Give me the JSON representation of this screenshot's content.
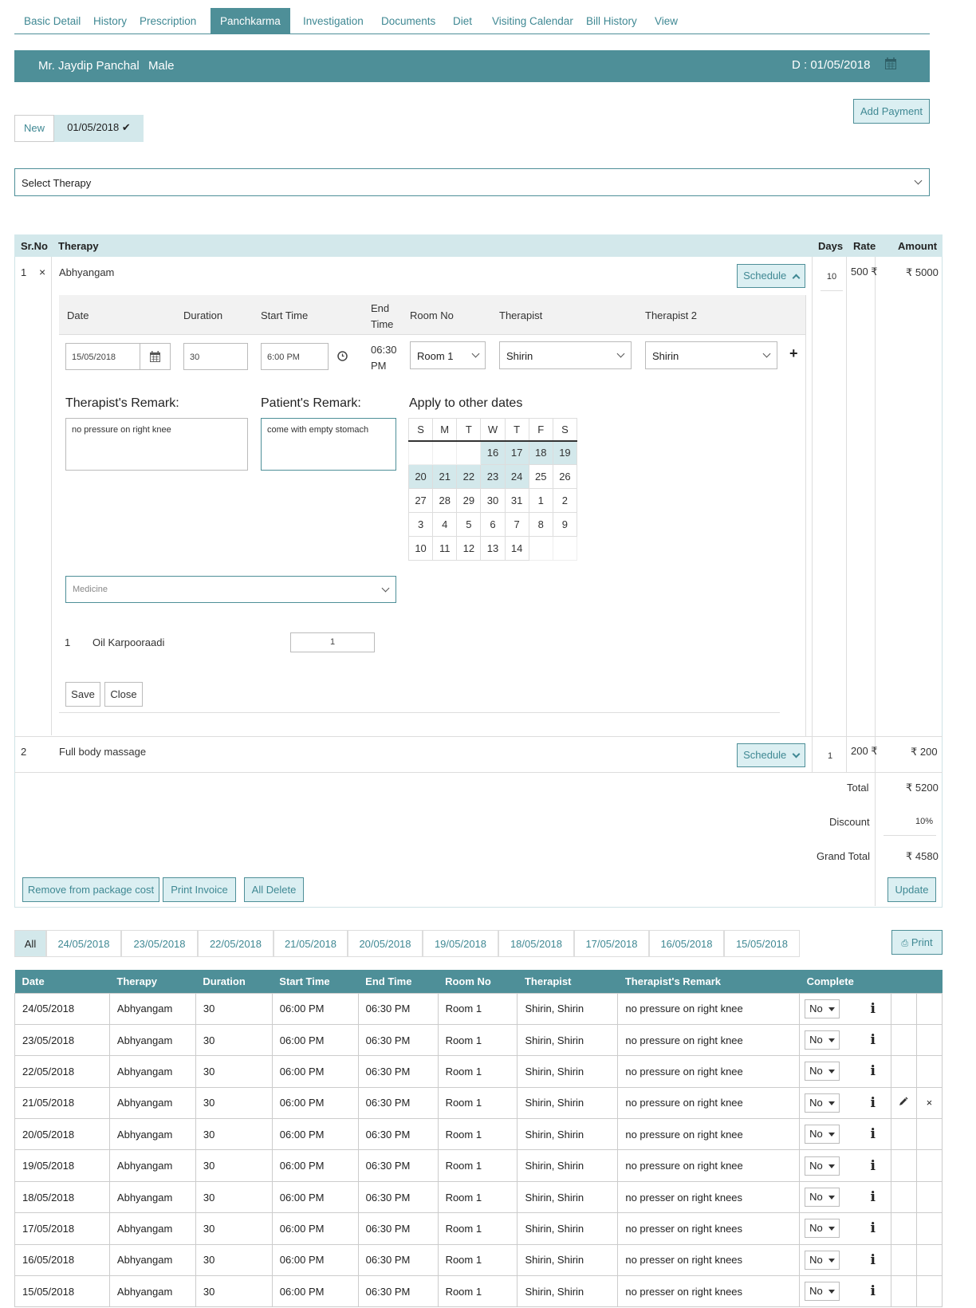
{
  "nav": {
    "tabs": [
      "Basic Detail",
      "History",
      "Prescription",
      "Panchkarma",
      "Investigation",
      "Documents",
      "Diet",
      "Visiting Calendar",
      "Bill History",
      "View"
    ],
    "active": "Panchkarma"
  },
  "patient": {
    "name": "Mr. Jaydip Panchal",
    "gender": "Male",
    "date": "D : 01/05/2018"
  },
  "add_payment": "Add Payment",
  "visit_tabs": {
    "new": "New",
    "date": "01/05/2018 ✔"
  },
  "select_therapy": "Select Therapy",
  "table_header": {
    "srno": "Sr.No",
    "therapy": "Therapy",
    "days": "Days",
    "rate": "Rate",
    "amount": "Amount"
  },
  "rows": [
    {
      "sr": "1",
      "remove": "×",
      "therapy": "Abhyangam",
      "schedule": "Schedule",
      "days": "10",
      "rate": "500 ₹",
      "amount": "₹ 5000"
    },
    {
      "sr": "2",
      "therapy": "Full body massage",
      "schedule": "Schedule",
      "days": "1",
      "rate": "200 ₹",
      "amount": "₹ 200"
    }
  ],
  "schedule_form": {
    "headers": {
      "date": "Date",
      "duration": "Duration",
      "start": "Start Time",
      "end": "End Time",
      "room": "Room No",
      "therapist": "Therapist",
      "therapist2": "Therapist 2"
    },
    "date": "15/05/2018",
    "duration": "30",
    "start": "6:00 PM",
    "end": "06:30 PM",
    "room": "Room 1",
    "therapist": "Shirin",
    "therapist2": "Shirin",
    "therapist_remark_label": "Therapist's Remark:",
    "therapist_remark": "no pressure on right knee",
    "patient_remark_label": "Patient's Remark:",
    "patient_remark": "come with empty stomach",
    "apply_label": "Apply to other dates",
    "calendar": {
      "days": [
        "S",
        "M",
        "T",
        "W",
        "T",
        "F",
        "S"
      ],
      "weeks": [
        [
          "",
          "",
          "",
          "16",
          "17",
          "18",
          "19"
        ],
        [
          "20",
          "21",
          "22",
          "23",
          "24",
          "25",
          "26"
        ],
        [
          "27",
          "28",
          "29",
          "30",
          "31",
          "1",
          "2"
        ],
        [
          "3",
          "4",
          "5",
          "6",
          "7",
          "8",
          "9"
        ],
        [
          "10",
          "11",
          "12",
          "13",
          "14",
          "",
          ""
        ]
      ],
      "selected": [
        "16",
        "17",
        "18",
        "19",
        "20",
        "21",
        "22",
        "23",
        "24"
      ]
    },
    "medicine_placeholder": "Medicine",
    "medicine": {
      "no": "1",
      "name": "Oil Karpooraadi",
      "qty": "1"
    },
    "save": "Save",
    "close": "Close"
  },
  "totals": {
    "total_label": "Total",
    "total": "₹ 5200",
    "discount_label": "Discount",
    "discount": "10%",
    "grand_label": "Grand Total",
    "grand": "₹ 4580"
  },
  "actions": {
    "remove_pkg": "Remove from package cost",
    "print_invoice": "Print Invoice",
    "all_delete": "All Delete",
    "update": "Update"
  },
  "date_tabs": [
    "All",
    "24/05/2018",
    "23/05/2018",
    "22/05/2018",
    "21/05/2018",
    "20/05/2018",
    "19/05/2018",
    "18/05/2018",
    "17/05/2018",
    "16/05/2018",
    "15/05/2018"
  ],
  "print": "Print",
  "schedule_table": {
    "headers": [
      "Date",
      "Therapy",
      "Duration",
      "Start Time",
      "End Time",
      "Room No",
      "Therapist",
      "Therapist's Remark",
      "Complete"
    ],
    "rows": [
      {
        "date": "24/05/2018",
        "therapy": "Abhyangam",
        "duration": "30",
        "start": "06:00 PM",
        "end": "06:30 PM",
        "room": "Room 1",
        "therapist": "Shirin, Shirin",
        "remark": "no pressure on right knee",
        "complete": "No"
      },
      {
        "date": "23/05/2018",
        "therapy": "Abhyangam",
        "duration": "30",
        "start": "06:00 PM",
        "end": "06:30 PM",
        "room": "Room 1",
        "therapist": "Shirin, Shirin",
        "remark": "no pressure on right knee",
        "complete": "No"
      },
      {
        "date": "22/05/2018",
        "therapy": "Abhyangam",
        "duration": "30",
        "start": "06:00 PM",
        "end": "06:30 PM",
        "room": "Room 1",
        "therapist": "Shirin, Shirin",
        "remark": "no pressure on right knee",
        "complete": "No"
      },
      {
        "date": "21/05/2018",
        "therapy": "Abhyangam",
        "duration": "30",
        "start": "06:00 PM",
        "end": "06:30 PM",
        "room": "Room 1",
        "therapist": "Shirin, Shirin",
        "remark": "no pressure on right knee",
        "complete": "No"
      },
      {
        "date": "20/05/2018",
        "therapy": "Abhyangam",
        "duration": "30",
        "start": "06:00 PM",
        "end": "06:30 PM",
        "room": "Room 1",
        "therapist": "Shirin, Shirin",
        "remark": "no pressure on right knee",
        "complete": "No"
      },
      {
        "date": "19/05/2018",
        "therapy": "Abhyangam",
        "duration": "30",
        "start": "06:00 PM",
        "end": "06:30 PM",
        "room": "Room 1",
        "therapist": "Shirin, Shirin",
        "remark": "no pressure on right knee",
        "complete": "No"
      },
      {
        "date": "18/05/2018",
        "therapy": "Abhyangam",
        "duration": "30",
        "start": "06:00 PM",
        "end": "06:30 PM",
        "room": "Room 1",
        "therapist": "Shirin, Shirin",
        "remark": "no presser on right knees",
        "complete": "No"
      },
      {
        "date": "17/05/2018",
        "therapy": "Abhyangam",
        "duration": "30",
        "start": "06:00 PM",
        "end": "06:30 PM",
        "room": "Room 1",
        "therapist": "Shirin, Shirin",
        "remark": "no presser on right knees",
        "complete": "No"
      },
      {
        "date": "16/05/2018",
        "therapy": "Abhyangam",
        "duration": "30",
        "start": "06:00 PM",
        "end": "06:30 PM",
        "room": "Room 1",
        "therapist": "Shirin, Shirin",
        "remark": "no presser on right knees",
        "complete": "No"
      },
      {
        "date": "15/05/2018",
        "therapy": "Abhyangam",
        "duration": "30",
        "start": "06:00 PM",
        "end": "06:30 PM",
        "room": "Room 1",
        "therapist": "Shirin, Shirin",
        "remark": "no presser on right knees",
        "complete": "No"
      }
    ],
    "editable_row": "21/05/2018"
  },
  "colors": {
    "accent": "#4e8f98",
    "light": "#d3e8eb"
  }
}
